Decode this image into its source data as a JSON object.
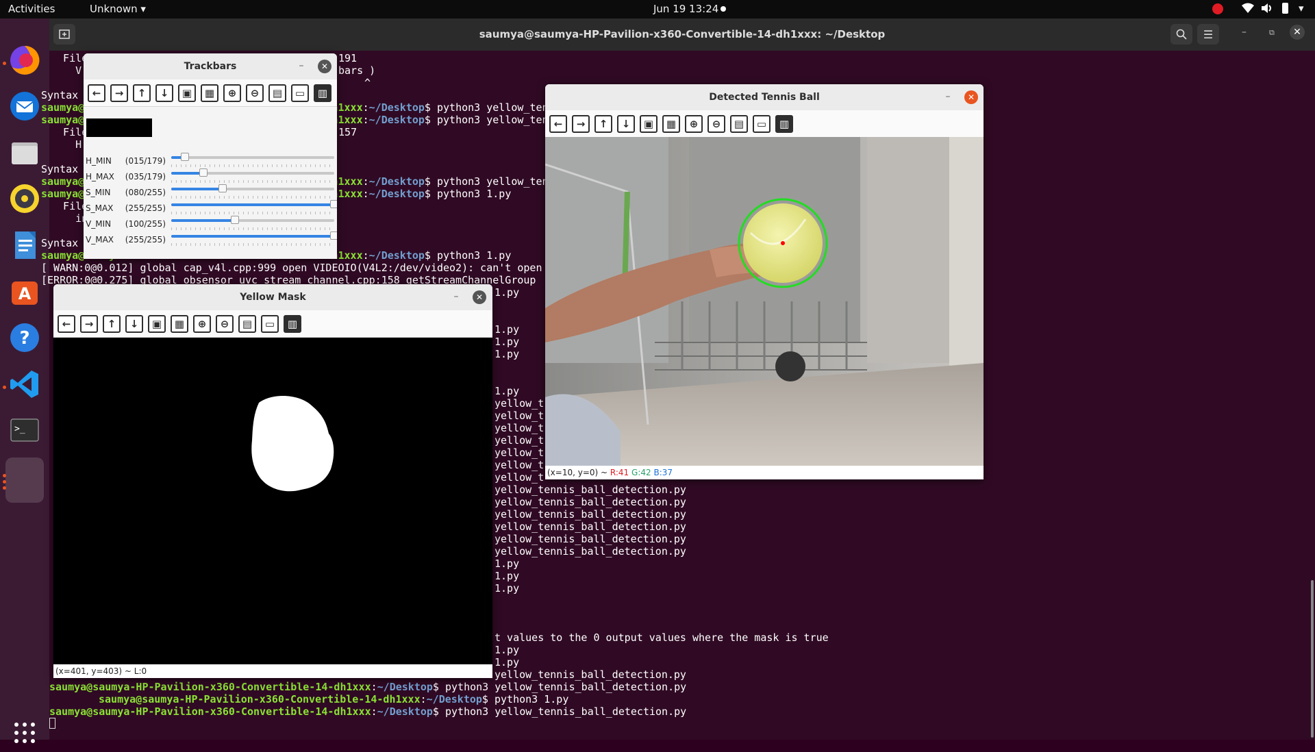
{
  "topbar": {
    "activities": "Activities",
    "app_menu": "Unknown",
    "clock": "Jun 19  13:24"
  },
  "dock": {
    "items": [
      {
        "name": "firefox-icon"
      },
      {
        "name": "thunderbird-icon"
      },
      {
        "name": "files-icon"
      },
      {
        "name": "rhythmbox-icon"
      },
      {
        "name": "libreoffice-writer-icon"
      },
      {
        "name": "software-center-icon"
      },
      {
        "name": "help-icon"
      },
      {
        "name": "vscode-icon"
      },
      {
        "name": "terminal-icon"
      },
      {
        "name": "opencv-window-icon"
      }
    ],
    "app_grid_label": "Show Applications"
  },
  "terminal": {
    "title": "saumya@saumya-HP-Pavilion-x360-Convertible-14-dh1xxx: ~/Desktop",
    "prompt_user": "saumya@saumya-HP-Pavilion-x360-Convertible-14-dh1xxx",
    "prompt_path": "~/Desktop",
    "lines": [
      "  File",
      "    V",
      "Syntax",
      "  File",
      "    H",
      "Syntax",
      "  File",
      "    in",
      "Syntax",
      "[ WARN:0@0.012] global cap_v4l.cpp:999 open VIDEOIO(V4L2:/dev/video2): can't open",
      "[ERROR:0@0.275] global obsensor_uvc_stream_channel.cpp:158 getStreamChannelGroup",
      "t values to the 0 output values where the mask is true"
    ],
    "fragments": {
      "f191": "191",
      "fbars": "bars )",
      "fcaret": "^",
      "f157": "157",
      "f1py": "1.py",
      "yellow_short": "yellow_t",
      "yellow_full": "yellow_tennis_ball_detection.py"
    },
    "commands": [
      "$ python3 yellow_tennis_ball_detection.py",
      "$ python3 1.py",
      "$ python3 yellow_tennis_ball_detection.py"
    ]
  },
  "trackbars_window": {
    "title": "Trackbars",
    "sliders": [
      {
        "name": "H_MIN",
        "display": "(015/179)",
        "value": 15,
        "max": 179
      },
      {
        "name": "H_MAX",
        "display": "(035/179)",
        "value": 35,
        "max": 179
      },
      {
        "name": "S_MIN",
        "display": "(080/255)",
        "value": 80,
        "max": 255
      },
      {
        "name": "S_MAX",
        "display": "(255/255)",
        "value": 255,
        "max": 255
      },
      {
        "name": "V_MIN",
        "display": "(100/255)",
        "value": 100,
        "max": 255
      },
      {
        "name": "V_MAX",
        "display": "(255/255)",
        "value": 255,
        "max": 255
      }
    ]
  },
  "mask_window": {
    "title": "Yellow Mask",
    "status": "(x=401, y=403) ~ L:0"
  },
  "ball_window": {
    "title": "Detected Tennis Ball",
    "status_prefix": "(x=10, y=0) ~ ",
    "r": "R:41",
    "g": "G:42",
    "b": "B:37"
  },
  "toolbar_buttons": [
    {
      "name": "pan-left-button",
      "glyph": "←"
    },
    {
      "name": "pan-right-button",
      "glyph": "→"
    },
    {
      "name": "pan-up-button",
      "glyph": "↑"
    },
    {
      "name": "pan-down-button",
      "glyph": "↓"
    },
    {
      "name": "zoom-original-button",
      "glyph": "▣"
    },
    {
      "name": "zoom-fit-button",
      "glyph": "▦"
    },
    {
      "name": "zoom-in-button",
      "glyph": "⊕"
    },
    {
      "name": "zoom-out-button",
      "glyph": "⊖"
    },
    {
      "name": "save-image-button",
      "glyph": "▤"
    },
    {
      "name": "copy-clipboard-button",
      "glyph": "▭"
    },
    {
      "name": "properties-button",
      "glyph": "▥"
    }
  ],
  "colors": {
    "accent": "#e95420",
    "prompt_green": "#8ae234",
    "prompt_blue": "#729fcf",
    "terminal_bg": "#300a24",
    "dock_bg": "#3b1b33",
    "detect_circle": "#22dd22",
    "center_dot": "#ff0000"
  }
}
